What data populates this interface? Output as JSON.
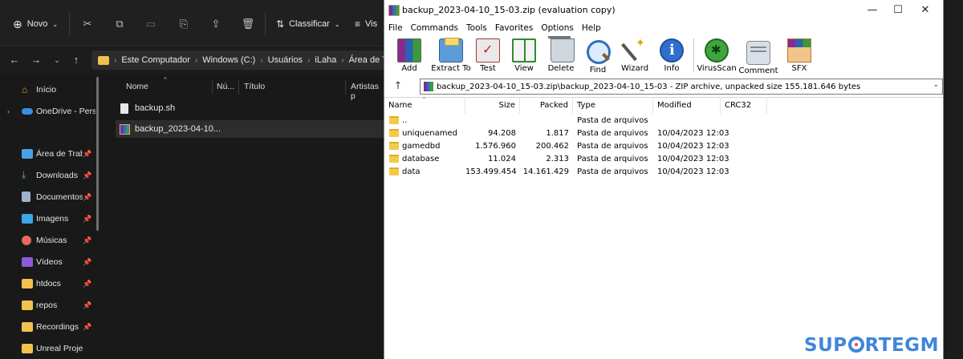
{
  "explorer": {
    "toolbar": {
      "new_label": "Novo",
      "sort_label": "Classificar",
      "view_label": "Vis"
    },
    "address": {
      "crumbs": [
        "Este Computador",
        "Windows (C:)",
        "Usuários",
        "iLaha",
        "Área de Trab"
      ]
    },
    "nav": {
      "items": [
        {
          "label": "Início"
        },
        {
          "label": "OneDrive - Pers"
        },
        {
          "label": "Área de Traba"
        },
        {
          "label": "Downloads"
        },
        {
          "label": "Documentos"
        },
        {
          "label": "Imagens"
        },
        {
          "label": "Músicas"
        },
        {
          "label": "Vídeos"
        },
        {
          "label": "htdocs"
        },
        {
          "label": "repos"
        },
        {
          "label": "Recordings"
        },
        {
          "label": "Unreal Projec"
        }
      ],
      "pin_glyph": "📌"
    },
    "columns": {
      "name": "Nome",
      "num": "Nú...",
      "title": "Título",
      "artists": "Artistas p"
    },
    "files": [
      {
        "name": "backup.sh",
        "icon": "document-icon"
      },
      {
        "name": "backup_2023-04-10...",
        "icon": "rar-archive-icon"
      }
    ]
  },
  "winrar": {
    "title": "backup_2023-04-10_15-03.zip (evaluation copy)",
    "window_controls": {
      "minimize": "—",
      "maximize": "☐",
      "close": "✕"
    },
    "menu": [
      "File",
      "Commands",
      "Tools",
      "Favorites",
      "Options",
      "Help"
    ],
    "tools": [
      {
        "label": "Add",
        "icon": "add-icon"
      },
      {
        "label": "Extract To",
        "icon": "extract-icon"
      },
      {
        "label": "Test",
        "icon": "test-icon"
      },
      {
        "label": "View",
        "icon": "view-icon"
      },
      {
        "label": "Delete",
        "icon": "delete-icon"
      },
      {
        "label": "Find",
        "icon": "find-icon"
      },
      {
        "label": "Wizard",
        "icon": "wizard-icon"
      },
      {
        "label": "Info",
        "icon": "info-icon"
      },
      {
        "label": "VirusScan",
        "icon": "virusscan-icon"
      },
      {
        "label": "Comment",
        "icon": "comment-icon"
      },
      {
        "label": "SFX",
        "icon": "sfx-icon"
      }
    ],
    "path": "backup_2023-04-10_15-03.zip\\backup_2023-04-10_15-03 - ZIP archive, unpacked size 155.181.646 bytes",
    "columns": {
      "name": "Name",
      "size": "Size",
      "packed": "Packed",
      "type": "Type",
      "modified": "Modified",
      "crc": "CRC32"
    },
    "rows": [
      {
        "name": "..",
        "size": "",
        "packed": "",
        "type": "Pasta de arquivos",
        "modified": ""
      },
      {
        "name": "uniquenamed",
        "size": "94.208",
        "packed": "1.817",
        "type": "Pasta de arquivos",
        "modified": "10/04/2023 12:03"
      },
      {
        "name": "gamedbd",
        "size": "1.576.960",
        "packed": "200.462",
        "type": "Pasta de arquivos",
        "modified": "10/04/2023 12:03"
      },
      {
        "name": "database",
        "size": "11.024",
        "packed": "2.313",
        "type": "Pasta de arquivos",
        "modified": "10/04/2023 12:03"
      },
      {
        "name": "data",
        "size": "153.499.454",
        "packed": "14.161.429",
        "type": "Pasta de arquivos",
        "modified": "10/04/2023 12:03"
      }
    ]
  },
  "watermark": {
    "before": "SUP",
    "after": "RTEGM"
  },
  "colors": {
    "explorer_bg": "#191919",
    "folder_yellow": "#f5c94a",
    "watermark_blue": "#3f86d9"
  }
}
